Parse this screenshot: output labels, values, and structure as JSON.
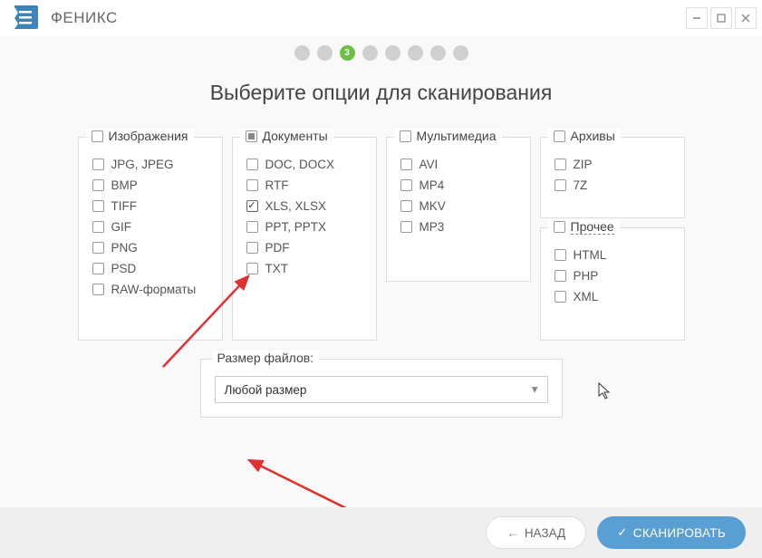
{
  "app": {
    "title": "ФЕНИКС"
  },
  "stepper": {
    "active_index": 2,
    "active_label": "3",
    "total": 8
  },
  "page": {
    "title": "Выберите опции для сканирования"
  },
  "groups": {
    "images": {
      "title": "Изображения",
      "items": [
        "JPG, JPEG",
        "BMP",
        "TIFF",
        "GIF",
        "PNG",
        "PSD",
        "RAW-форматы"
      ]
    },
    "documents": {
      "title": "Документы",
      "items": [
        "DOC, DOCX",
        "RTF",
        "XLS, XLSX",
        "PPT, PPTX",
        "PDF",
        "TXT"
      ],
      "checked_index": 2
    },
    "multimedia": {
      "title": "Мультимедиа",
      "items": [
        "AVI",
        "MP4",
        "MKV",
        "MP3"
      ]
    },
    "archives": {
      "title": "Архивы",
      "items": [
        "ZIP",
        "7Z"
      ]
    },
    "other": {
      "title": "Прочее",
      "items": [
        "HTML",
        "PHP",
        "XML"
      ]
    }
  },
  "filesize": {
    "legend": "Размер файлов:",
    "selected": "Любой размер"
  },
  "buttons": {
    "back": "НАЗАД",
    "scan": "СКАНИРОВАТЬ"
  }
}
